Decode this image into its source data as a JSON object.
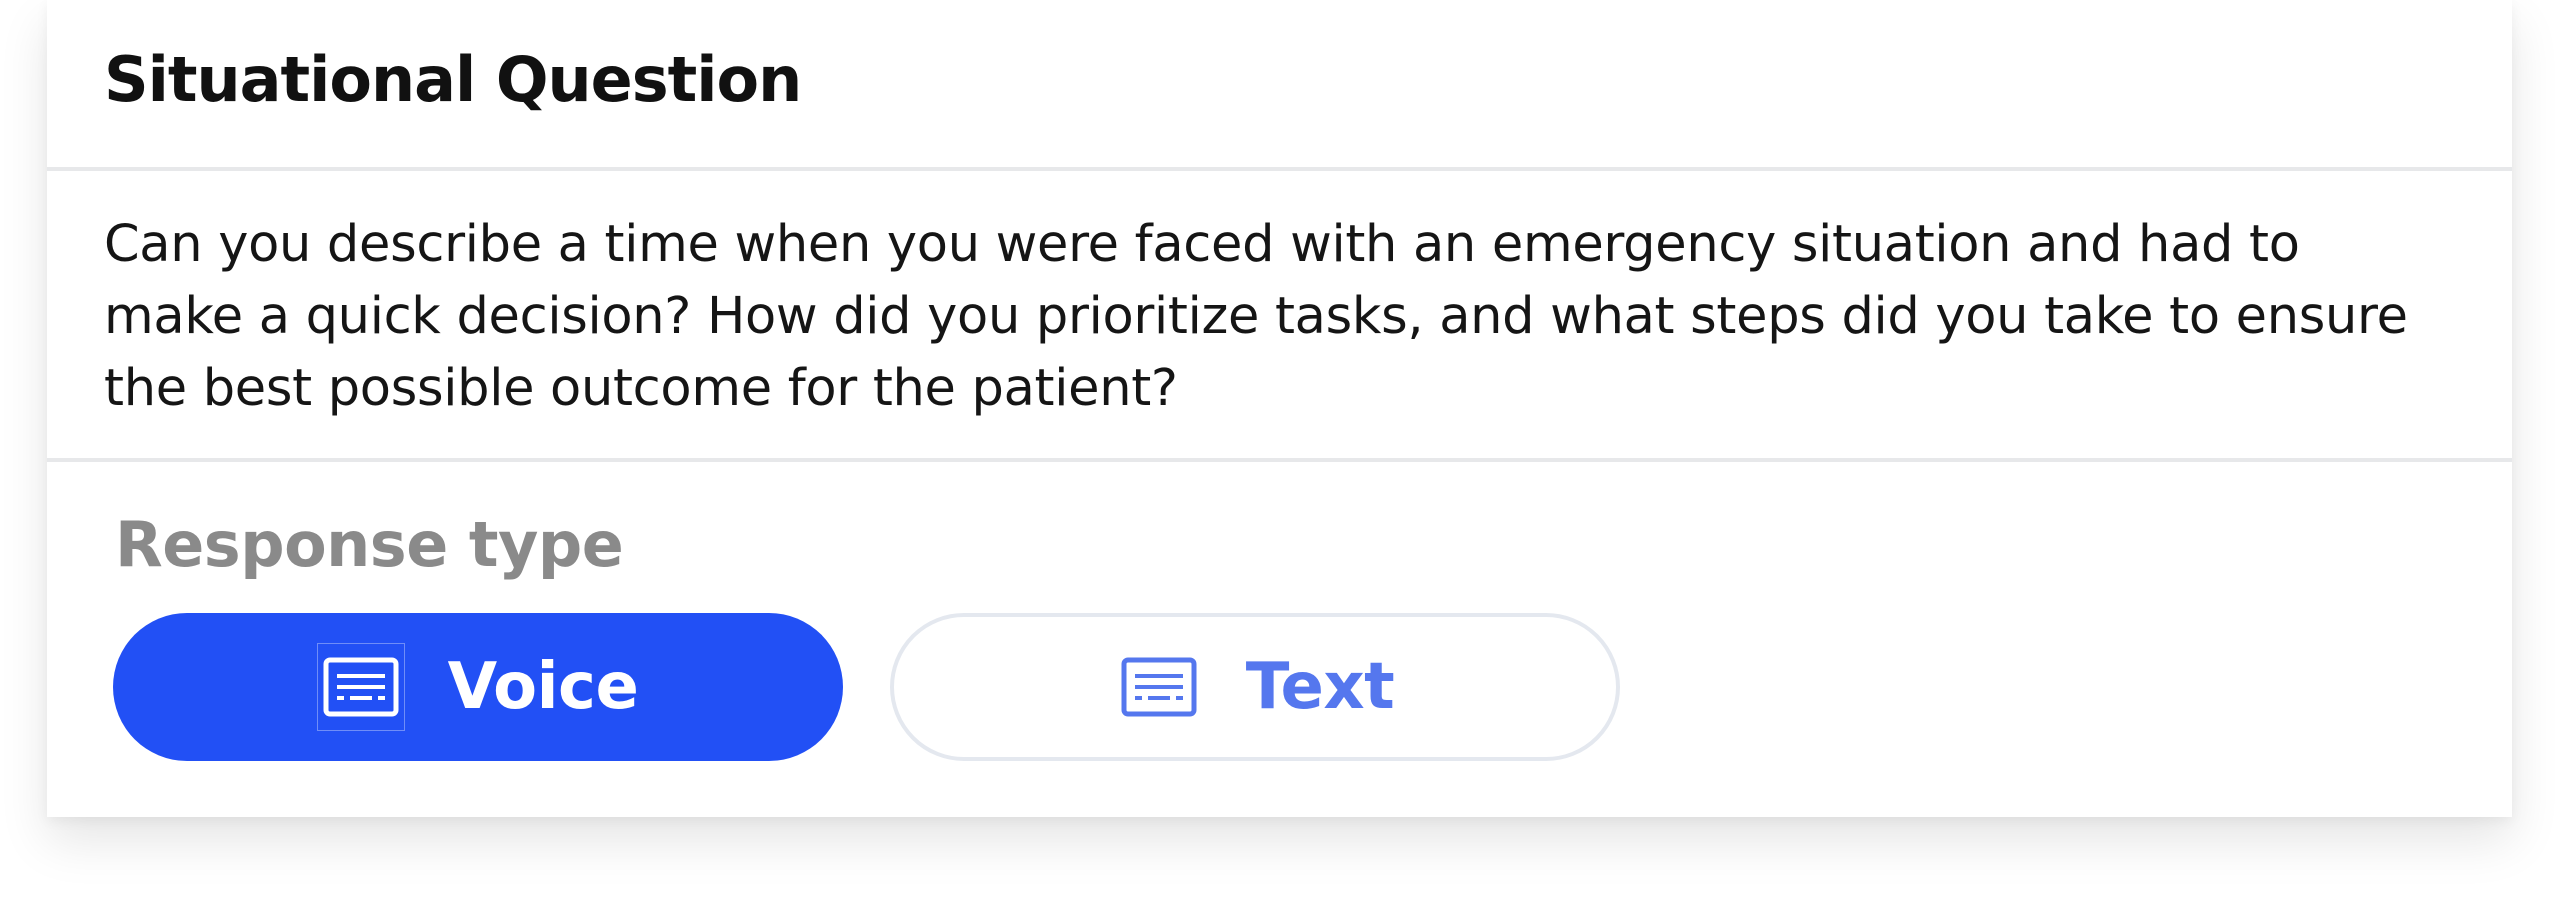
{
  "card": {
    "title": "Situational Question",
    "question": "Can you describe a time when you were faced with an emergency situation and had to make a quick decision? How did you prioritize tasks, and what steps did you take to ensure the best possible outcome for the patient?"
  },
  "response": {
    "label": "Response type",
    "options": [
      {
        "label": "Voice",
        "icon": "keyboard-icon",
        "selected": true
      },
      {
        "label": "Text",
        "icon": "keyboard-icon",
        "selected": false
      }
    ]
  },
  "colors": {
    "accent": "#2250f5",
    "accent_text": "#5577ee",
    "label_gray": "#8a8a8a",
    "divider": "#e7e8ea"
  }
}
